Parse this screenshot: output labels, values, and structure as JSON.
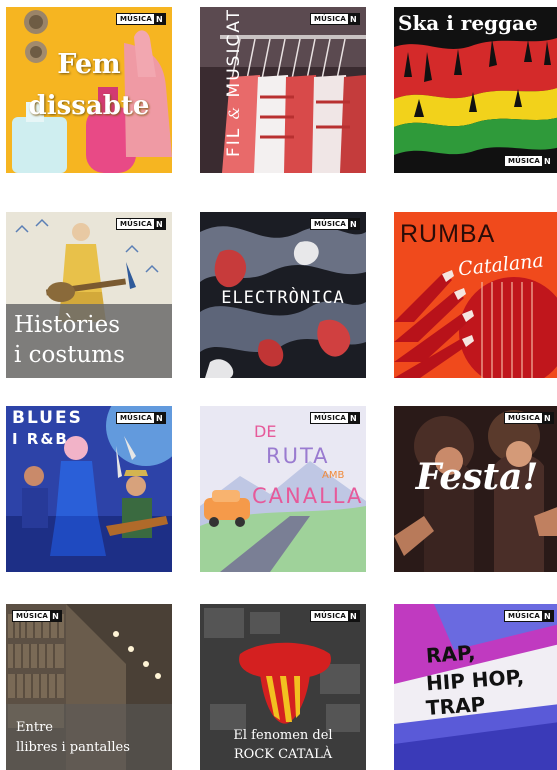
{
  "brand": {
    "badge_text": "MÚSICA",
    "badge_mark": "N"
  },
  "playlists": [
    {
      "title_line1": "Fem",
      "title_line2": "dissabte"
    },
    {
      "title_line1": "FIL",
      "title_amp": "&",
      "title_line2": "MUSICAT"
    },
    {
      "title": "Ska i reggae"
    },
    {
      "title_line1": "Històries",
      "title_line2": "i costums"
    },
    {
      "title": "ELECTRÒNICA"
    },
    {
      "title_line1": "RUMBA",
      "title_line2": "Catalana"
    },
    {
      "title_line1": "BLUES",
      "title_line2": "I R&B"
    },
    {
      "title_line1": "DE",
      "title_line2": "RUTA",
      "title_amb": "AMB",
      "title_line3": "CANALLA"
    },
    {
      "title": "Festa!"
    },
    {
      "title_line1": "Entre",
      "title_line2": "llibres i pantalles"
    },
    {
      "title_line1": "El fenomen del",
      "title_line2": "ROCK CATALÀ"
    },
    {
      "title_line1": "RAP,",
      "title_line2": "HIP HOP,",
      "title_line3": "TRAP"
    }
  ]
}
